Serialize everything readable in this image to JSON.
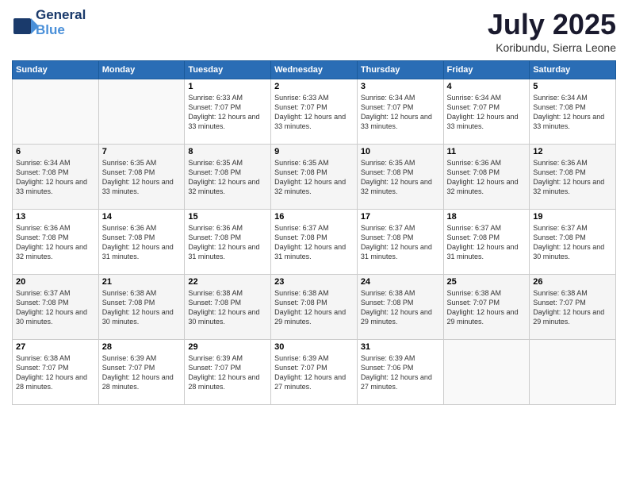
{
  "header": {
    "logo_line1": "General",
    "logo_line2": "Blue",
    "month_title": "July 2025",
    "location": "Koribundu, Sierra Leone"
  },
  "days_of_week": [
    "Sunday",
    "Monday",
    "Tuesday",
    "Wednesday",
    "Thursday",
    "Friday",
    "Saturday"
  ],
  "weeks": [
    [
      {
        "day": "",
        "sunrise": "",
        "sunset": "",
        "daylight": "",
        "empty": true
      },
      {
        "day": "",
        "sunrise": "",
        "sunset": "",
        "daylight": "",
        "empty": true
      },
      {
        "day": "1",
        "sunrise": "Sunrise: 6:33 AM",
        "sunset": "Sunset: 7:07 PM",
        "daylight": "Daylight: 12 hours and 33 minutes."
      },
      {
        "day": "2",
        "sunrise": "Sunrise: 6:33 AM",
        "sunset": "Sunset: 7:07 PM",
        "daylight": "Daylight: 12 hours and 33 minutes."
      },
      {
        "day": "3",
        "sunrise": "Sunrise: 6:34 AM",
        "sunset": "Sunset: 7:07 PM",
        "daylight": "Daylight: 12 hours and 33 minutes."
      },
      {
        "day": "4",
        "sunrise": "Sunrise: 6:34 AM",
        "sunset": "Sunset: 7:07 PM",
        "daylight": "Daylight: 12 hours and 33 minutes."
      },
      {
        "day": "5",
        "sunrise": "Sunrise: 6:34 AM",
        "sunset": "Sunset: 7:08 PM",
        "daylight": "Daylight: 12 hours and 33 minutes."
      }
    ],
    [
      {
        "day": "6",
        "sunrise": "Sunrise: 6:34 AM",
        "sunset": "Sunset: 7:08 PM",
        "daylight": "Daylight: 12 hours and 33 minutes."
      },
      {
        "day": "7",
        "sunrise": "Sunrise: 6:35 AM",
        "sunset": "Sunset: 7:08 PM",
        "daylight": "Daylight: 12 hours and 33 minutes."
      },
      {
        "day": "8",
        "sunrise": "Sunrise: 6:35 AM",
        "sunset": "Sunset: 7:08 PM",
        "daylight": "Daylight: 12 hours and 32 minutes."
      },
      {
        "day": "9",
        "sunrise": "Sunrise: 6:35 AM",
        "sunset": "Sunset: 7:08 PM",
        "daylight": "Daylight: 12 hours and 32 minutes."
      },
      {
        "day": "10",
        "sunrise": "Sunrise: 6:35 AM",
        "sunset": "Sunset: 7:08 PM",
        "daylight": "Daylight: 12 hours and 32 minutes."
      },
      {
        "day": "11",
        "sunrise": "Sunrise: 6:36 AM",
        "sunset": "Sunset: 7:08 PM",
        "daylight": "Daylight: 12 hours and 32 minutes."
      },
      {
        "day": "12",
        "sunrise": "Sunrise: 6:36 AM",
        "sunset": "Sunset: 7:08 PM",
        "daylight": "Daylight: 12 hours and 32 minutes."
      }
    ],
    [
      {
        "day": "13",
        "sunrise": "Sunrise: 6:36 AM",
        "sunset": "Sunset: 7:08 PM",
        "daylight": "Daylight: 12 hours and 32 minutes."
      },
      {
        "day": "14",
        "sunrise": "Sunrise: 6:36 AM",
        "sunset": "Sunset: 7:08 PM",
        "daylight": "Daylight: 12 hours and 31 minutes."
      },
      {
        "day": "15",
        "sunrise": "Sunrise: 6:36 AM",
        "sunset": "Sunset: 7:08 PM",
        "daylight": "Daylight: 12 hours and 31 minutes."
      },
      {
        "day": "16",
        "sunrise": "Sunrise: 6:37 AM",
        "sunset": "Sunset: 7:08 PM",
        "daylight": "Daylight: 12 hours and 31 minutes."
      },
      {
        "day": "17",
        "sunrise": "Sunrise: 6:37 AM",
        "sunset": "Sunset: 7:08 PM",
        "daylight": "Daylight: 12 hours and 31 minutes."
      },
      {
        "day": "18",
        "sunrise": "Sunrise: 6:37 AM",
        "sunset": "Sunset: 7:08 PM",
        "daylight": "Daylight: 12 hours and 31 minutes."
      },
      {
        "day": "19",
        "sunrise": "Sunrise: 6:37 AM",
        "sunset": "Sunset: 7:08 PM",
        "daylight": "Daylight: 12 hours and 30 minutes."
      }
    ],
    [
      {
        "day": "20",
        "sunrise": "Sunrise: 6:37 AM",
        "sunset": "Sunset: 7:08 PM",
        "daylight": "Daylight: 12 hours and 30 minutes."
      },
      {
        "day": "21",
        "sunrise": "Sunrise: 6:38 AM",
        "sunset": "Sunset: 7:08 PM",
        "daylight": "Daylight: 12 hours and 30 minutes."
      },
      {
        "day": "22",
        "sunrise": "Sunrise: 6:38 AM",
        "sunset": "Sunset: 7:08 PM",
        "daylight": "Daylight: 12 hours and 30 minutes."
      },
      {
        "day": "23",
        "sunrise": "Sunrise: 6:38 AM",
        "sunset": "Sunset: 7:08 PM",
        "daylight": "Daylight: 12 hours and 29 minutes."
      },
      {
        "day": "24",
        "sunrise": "Sunrise: 6:38 AM",
        "sunset": "Sunset: 7:08 PM",
        "daylight": "Daylight: 12 hours and 29 minutes."
      },
      {
        "day": "25",
        "sunrise": "Sunrise: 6:38 AM",
        "sunset": "Sunset: 7:07 PM",
        "daylight": "Daylight: 12 hours and 29 minutes."
      },
      {
        "day": "26",
        "sunrise": "Sunrise: 6:38 AM",
        "sunset": "Sunset: 7:07 PM",
        "daylight": "Daylight: 12 hours and 29 minutes."
      }
    ],
    [
      {
        "day": "27",
        "sunrise": "Sunrise: 6:38 AM",
        "sunset": "Sunset: 7:07 PM",
        "daylight": "Daylight: 12 hours and 28 minutes."
      },
      {
        "day": "28",
        "sunrise": "Sunrise: 6:39 AM",
        "sunset": "Sunset: 7:07 PM",
        "daylight": "Daylight: 12 hours and 28 minutes."
      },
      {
        "day": "29",
        "sunrise": "Sunrise: 6:39 AM",
        "sunset": "Sunset: 7:07 PM",
        "daylight": "Daylight: 12 hours and 28 minutes."
      },
      {
        "day": "30",
        "sunrise": "Sunrise: 6:39 AM",
        "sunset": "Sunset: 7:07 PM",
        "daylight": "Daylight: 12 hours and 27 minutes."
      },
      {
        "day": "31",
        "sunrise": "Sunrise: 6:39 AM",
        "sunset": "Sunset: 7:06 PM",
        "daylight": "Daylight: 12 hours and 27 minutes."
      },
      {
        "day": "",
        "sunrise": "",
        "sunset": "",
        "daylight": "",
        "empty": true
      },
      {
        "day": "",
        "sunrise": "",
        "sunset": "",
        "daylight": "",
        "empty": true
      }
    ]
  ]
}
